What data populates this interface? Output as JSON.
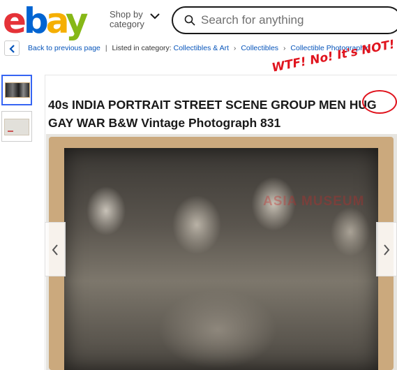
{
  "header": {
    "logo": [
      "e",
      "b",
      "a",
      "y"
    ],
    "shop_by": "Shop by",
    "shop_by_2": "category",
    "search_placeholder": "Search for anything"
  },
  "breadcrumb": {
    "back": "Back to previous page",
    "sep": "|",
    "listed_in": "Listed in category:",
    "items": [
      "Collectibles & Art",
      "Collectibles",
      "Collectible Photographic"
    ]
  },
  "listing": {
    "title": "40s INDIA PORTRAIT STREET SCENE GROUP MEN HUG GAY WAR B&W Vintage Photograph 831",
    "watermark": "ASIA MUSEUM"
  },
  "annotation": {
    "text": "WTF! No! It's NOT!"
  },
  "colors": {
    "accent": "#3665f3",
    "link": "#0654ba",
    "annotation_red": "#e0141e"
  }
}
